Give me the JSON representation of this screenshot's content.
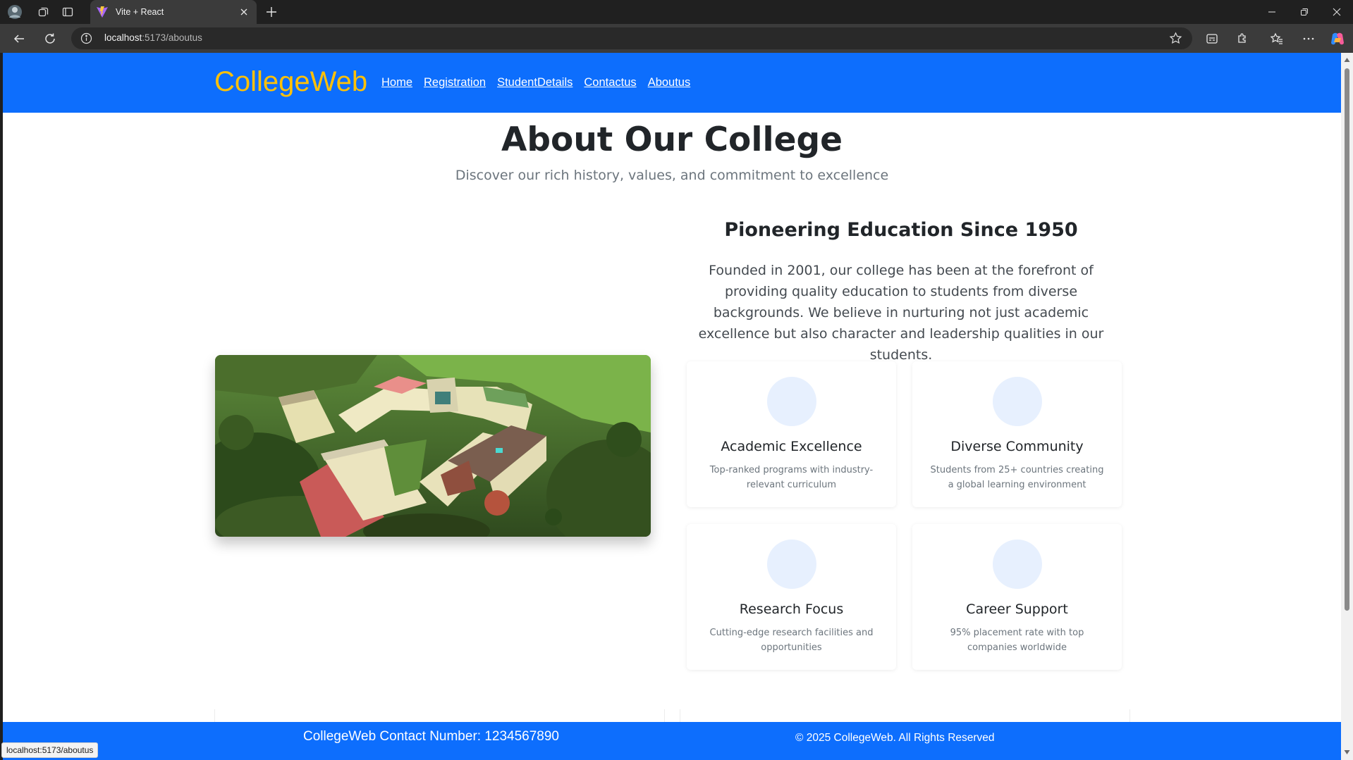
{
  "browser": {
    "tab_title": "Vite + React",
    "url_host": "localhost",
    "url_path": ":5173/aboutus",
    "status_url": "localhost:5173/aboutus"
  },
  "site": {
    "brand": "CollegeWeb",
    "nav": [
      "Home",
      "Registration",
      "StudentDetails",
      "Contactus",
      "Aboutus"
    ]
  },
  "hero": {
    "title": "About Our College",
    "subtitle": "Discover our rich history, values, and commitment to excellence"
  },
  "about": {
    "heading": "Pioneering Education Since 1950",
    "body": "Founded in 2001, our college has been at the forefront of providing quality education to students from diverse backgrounds. We believe in nurturing not just academic excellence but also character and leadership qualities in our students."
  },
  "features": [
    {
      "title": "Academic Excellence",
      "desc": "Top-ranked programs with industry-relevant curriculum"
    },
    {
      "title": "Diverse Community",
      "desc": "Students from 25+ countries creating a global learning environment"
    },
    {
      "title": "Research Focus",
      "desc": "Cutting-edge research facilities and opportunities"
    },
    {
      "title": "Career Support",
      "desc": "95% placement rate with top companies worldwide"
    }
  ],
  "footer": {
    "contact": "CollegeWeb Contact Number: 1234567890",
    "copyright": "© 2025 CollegeWeb. All Rights Reserved"
  },
  "colors": {
    "primary": "#0d6efd",
    "brand": "#ffc107",
    "feature_circle": "#e7f0fe"
  },
  "icons": [
    "profile-icon",
    "workspaces-icon",
    "tab-actions-icon",
    "vite-favicon",
    "close-icon",
    "plus-icon",
    "minimize-icon",
    "restore-icon",
    "window-close-icon",
    "back-icon",
    "refresh-icon",
    "info-icon",
    "star-icon",
    "reader-icon",
    "extensions-icon",
    "favorites-icon",
    "more-icon",
    "copilot-icon"
  ]
}
